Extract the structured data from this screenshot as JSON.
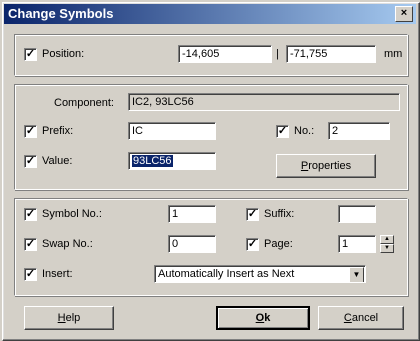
{
  "window": {
    "title": "Change Symbols",
    "close_glyph": "×"
  },
  "position": {
    "label": "Position:",
    "x": "-14,605",
    "separator": "|",
    "y": "-71,755",
    "unit": "mm",
    "checked": true
  },
  "component": {
    "label": "Component:",
    "value": "IC2, 93LC56"
  },
  "prefix": {
    "label": "Prefix:",
    "value": "IC",
    "checked": true
  },
  "number": {
    "label": "No.:",
    "value": "2",
    "checked": true
  },
  "value_field": {
    "label": "Value:",
    "value": "93LC56",
    "checked": true
  },
  "properties_button": {
    "label_first": "P",
    "label_rest": "roperties"
  },
  "symbol_no": {
    "label": "Symbol No.:",
    "value": "1",
    "checked": true
  },
  "suffix": {
    "label": "Suffix:",
    "value": "",
    "checked": true
  },
  "swap_no": {
    "label": "Swap No.:",
    "value": "0",
    "checked": true
  },
  "page": {
    "label": "Page:",
    "value": "1",
    "checked": true
  },
  "insert": {
    "label": "Insert:",
    "value": "Automatically Insert as Next",
    "checked": true
  },
  "buttons": {
    "help_first": "H",
    "help_rest": "elp",
    "ok_first": "O",
    "ok_rest": "k",
    "cancel_first": "C",
    "cancel_rest": "ancel"
  },
  "icons": {
    "check": "✓",
    "up": "▲",
    "down": "▼"
  }
}
